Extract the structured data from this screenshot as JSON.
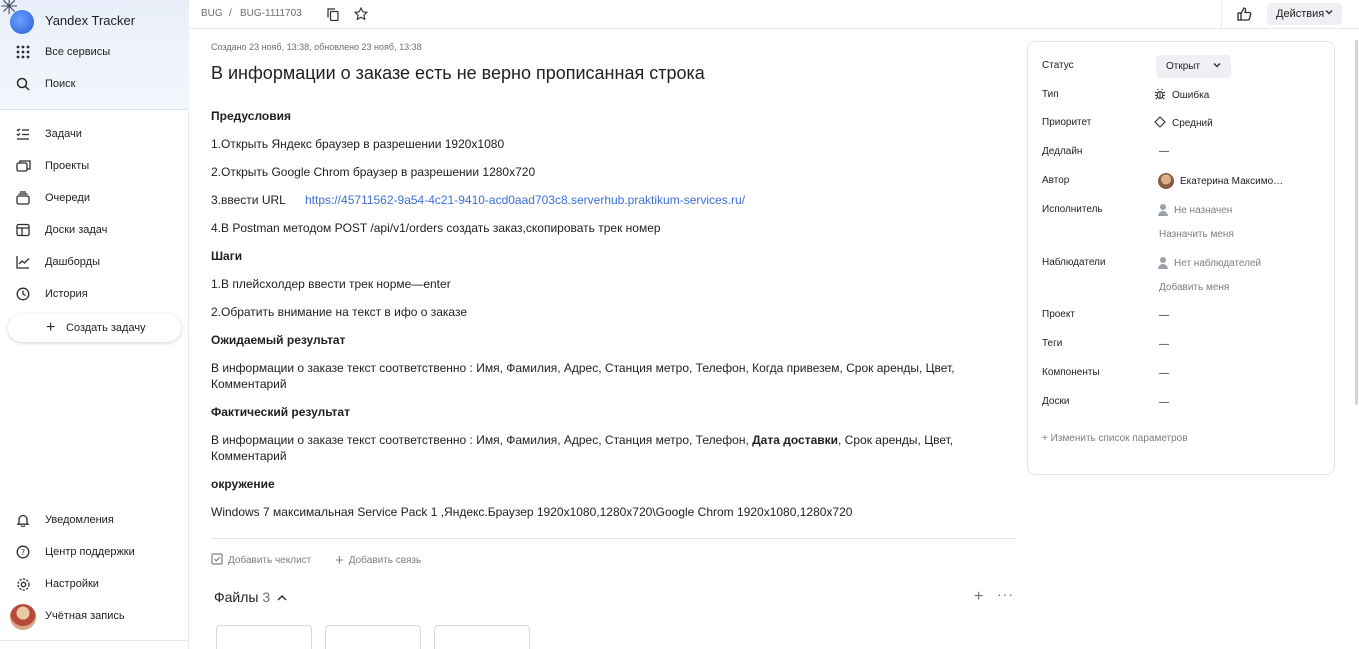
{
  "app": {
    "title": "Yandex Tracker"
  },
  "sidebar": {
    "top_items": [
      {
        "label": "Все сервисы",
        "icon": "grid-icon"
      },
      {
        "label": "Поиск",
        "icon": "search-icon"
      }
    ],
    "items": [
      {
        "label": "Задачи",
        "icon": "tasks-icon"
      },
      {
        "label": "Проекты",
        "icon": "projects-icon"
      },
      {
        "label": "Очереди",
        "icon": "queues-icon"
      },
      {
        "label": "Доски задач",
        "icon": "boards-icon"
      },
      {
        "label": "Дашборды",
        "icon": "dashboards-icon"
      },
      {
        "label": "История",
        "icon": "history-icon"
      }
    ],
    "create_label": "Создать задачу",
    "bottom_items": [
      {
        "label": "Уведомления",
        "icon": "bell-icon"
      },
      {
        "label": "Центр поддержки",
        "icon": "help-icon"
      },
      {
        "label": "Настройки",
        "icon": "gear-icon"
      },
      {
        "label": "Учётная запись",
        "icon": "avatar"
      }
    ]
  },
  "header": {
    "queue": "BUG",
    "separator": "/",
    "issue_key": "BUG-1111703",
    "actions_label": "Действия"
  },
  "issue": {
    "meta": "Создано 23 нояб, 13:38, обновлено 23 нояб, 13:38",
    "title": "В информации о заказе есть не верно прописанная строка",
    "sections": {
      "pre_heading": "Предусловия",
      "pre_1": "1.Открыть Яндекс браузер в разрешении 1920x1080",
      "pre_2": "2.Открыть Google Chrom браузер в разрешении 1280x720",
      "pre_3_label": "3.ввести URL",
      "pre_3_link": "https://45711562-9a54-4c21-9410-acd0aad703c8.serverhub.praktikum-services.ru/",
      "pre_4": "4.В Postman методом POST /api/v1/orders создать заказ,скопировать трек номер",
      "steps_heading": "Шаги",
      "step_1": "1.В плейсхолдер ввести трек норме—enter",
      "step_2": "2.Обратить внимание на текст в ифо о заказе",
      "expected_heading": "Ожидаемый результат",
      "expected_line1": "В информации о заказе текст соответственно : Имя, Фамилия, Адрес, Станция метро, Телефон, Когда привезем, Срок аренды, Цвет,",
      "expected_line2": "Комментарий",
      "actual_heading": "Фактический результат",
      "actual_line1_a": "В информации о заказе текст соответственно : Имя, Фамилия, Адрес, Станция метро, Телефон, ",
      "actual_line1_bold": "Дата доставки",
      "actual_line1_b": ", Срок аренды, Цвет,",
      "actual_line2": "Комментарий",
      "env_heading": "окружение",
      "env_text": "Windows 7 максимальная Service Pack 1 ,Яндекс.Браузер 1920x1080,1280x720\\Google Chrom 1920x1080,1280x720"
    },
    "add_checklist": "Добавить чеклист",
    "add_link": "Добавить связь",
    "files_label": "Файлы",
    "files_count": "3"
  },
  "panel": {
    "status_label": "Статус",
    "status_value": "Открыт",
    "type_label": "Тип",
    "type_value": "Ошибка",
    "priority_label": "Приоритет",
    "priority_value": "Средний",
    "deadline_label": "Дедлайн",
    "deadline_value": "—",
    "author_label": "Автор",
    "author_value": "Екатерина Максимо…",
    "assignee_label": "Исполнитель",
    "assignee_value": "Не назначен",
    "assign_me": "Назначить меня",
    "watchers_label": "Наблюдатели",
    "watchers_value": "Нет наблюдателей",
    "add_me": "Добавить меня",
    "project_label": "Проект",
    "project_value": "—",
    "tags_label": "Теги",
    "tags_value": "—",
    "components_label": "Компоненты",
    "components_value": "—",
    "boards_label": "Доски",
    "boards_value": "—",
    "change_params": "Изменить список параметров"
  }
}
